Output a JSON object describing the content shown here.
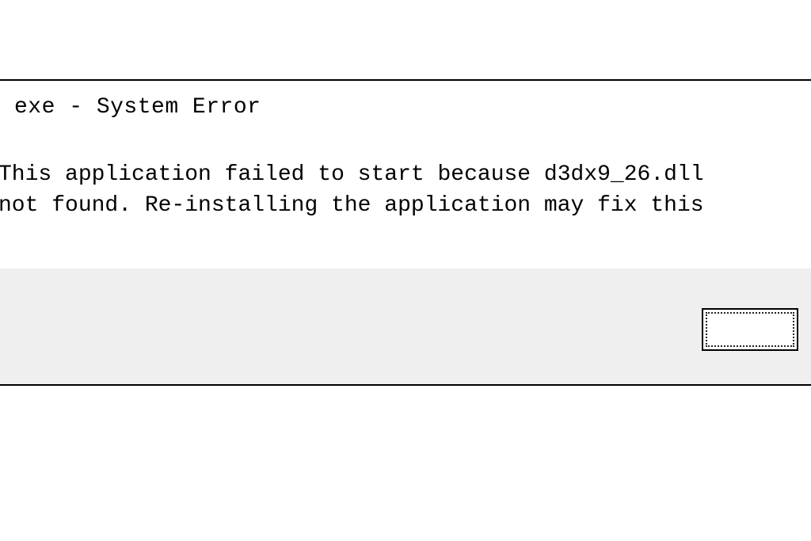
{
  "dialog": {
    "title": "exe - System Error",
    "message_line1": "This application failed to start because d3dx9_26.dll",
    "message_line2": "not found. Re-installing the application may fix this",
    "button_label": ""
  }
}
